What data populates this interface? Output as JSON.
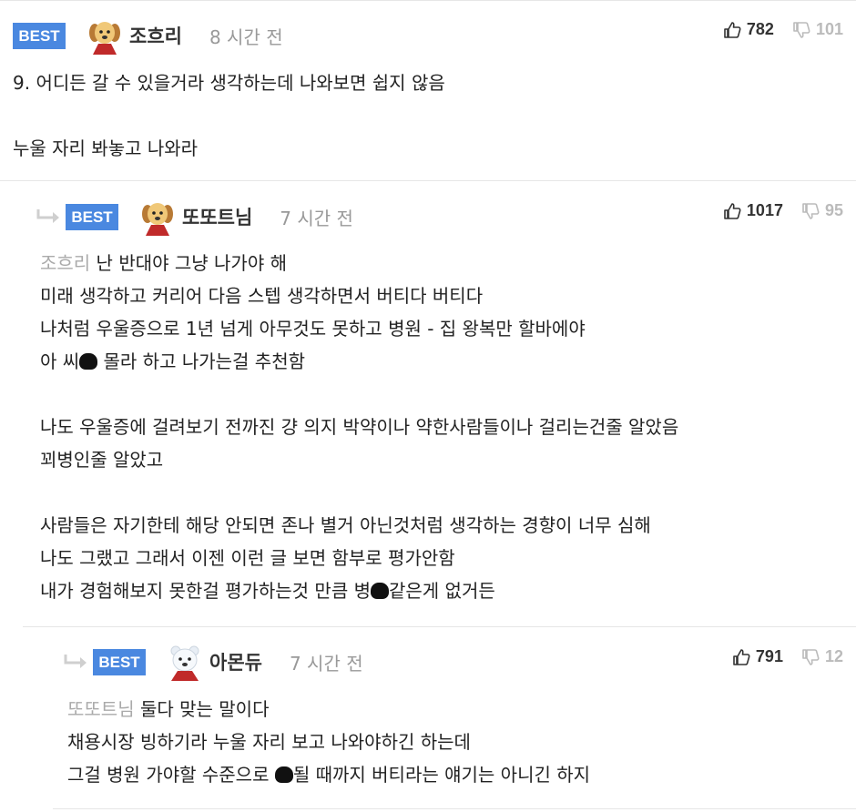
{
  "comments": [
    {
      "badge": "BEST",
      "nickname": "조흐리",
      "time": "8 시간 전",
      "upvotes": "782",
      "downvotes": "101",
      "lines": [
        "9. 어디든 갈 수 있을거라 생각하는데 나와보면 쉽지 않음",
        "",
        "누울 자리 봐놓고 나와라"
      ]
    },
    {
      "badge": "BEST",
      "nickname": "또또트님",
      "time": "7 시간 전",
      "upvotes": "1017",
      "downvotes": "95",
      "mention": "조흐리",
      "line1_rest": " 난 반대야 그냥 나가야 해",
      "line2": "미래 생각하고 커리어 다음 스텝 생각하면서 버티다 버티다",
      "line3": "나처럼 우울증으로 1년 넘게 아무것도 못하고 병원 - 집 왕복만 할바에야",
      "line4a": "아 씨",
      "line4b": " 몰라 하고 나가는걸 추천함",
      "line5": "나도 우울증에 걸려보기 전까진 걍 의지 박약이나 약한사람들이나 걸리는건줄 알았음",
      "line6": "꾀병인줄 알았고",
      "line7": "사람들은 자기한테 해당 안되면 존나 별거 아닌것처럼 생각하는 경향이 너무 심해",
      "line8": "나도 그랬고 그래서 이젠 이런 글 보면 함부로 평가안함",
      "line9a": "내가 경험해보지 못한걸 평가하는것 만큼 병",
      "line9b": "같은게 없거든"
    },
    {
      "badge": "BEST",
      "nickname": "아몬듀",
      "time": "7 시간 전",
      "upvotes": "791",
      "downvotes": "12",
      "mention": "또또트님",
      "line1_rest": " 둘다 맞는 말이다",
      "line2": "채용시장 빙하기라 누울 자리 보고 나와야하긴 하는데",
      "line3a": "그걸 병원 가야할 수준으로 ",
      "line3b": "될 때까지 버티라는 얘기는 아니긴 하지"
    }
  ],
  "icons": {
    "upvote": "thumbs-up-icon",
    "downvote": "thumbs-down-icon",
    "reply": "reply-arrow-icon",
    "avatar": "dog-avatar-icon"
  },
  "colors": {
    "badge": "#4a88e0",
    "mention": "#aaaaaa",
    "muted": "#999999"
  }
}
